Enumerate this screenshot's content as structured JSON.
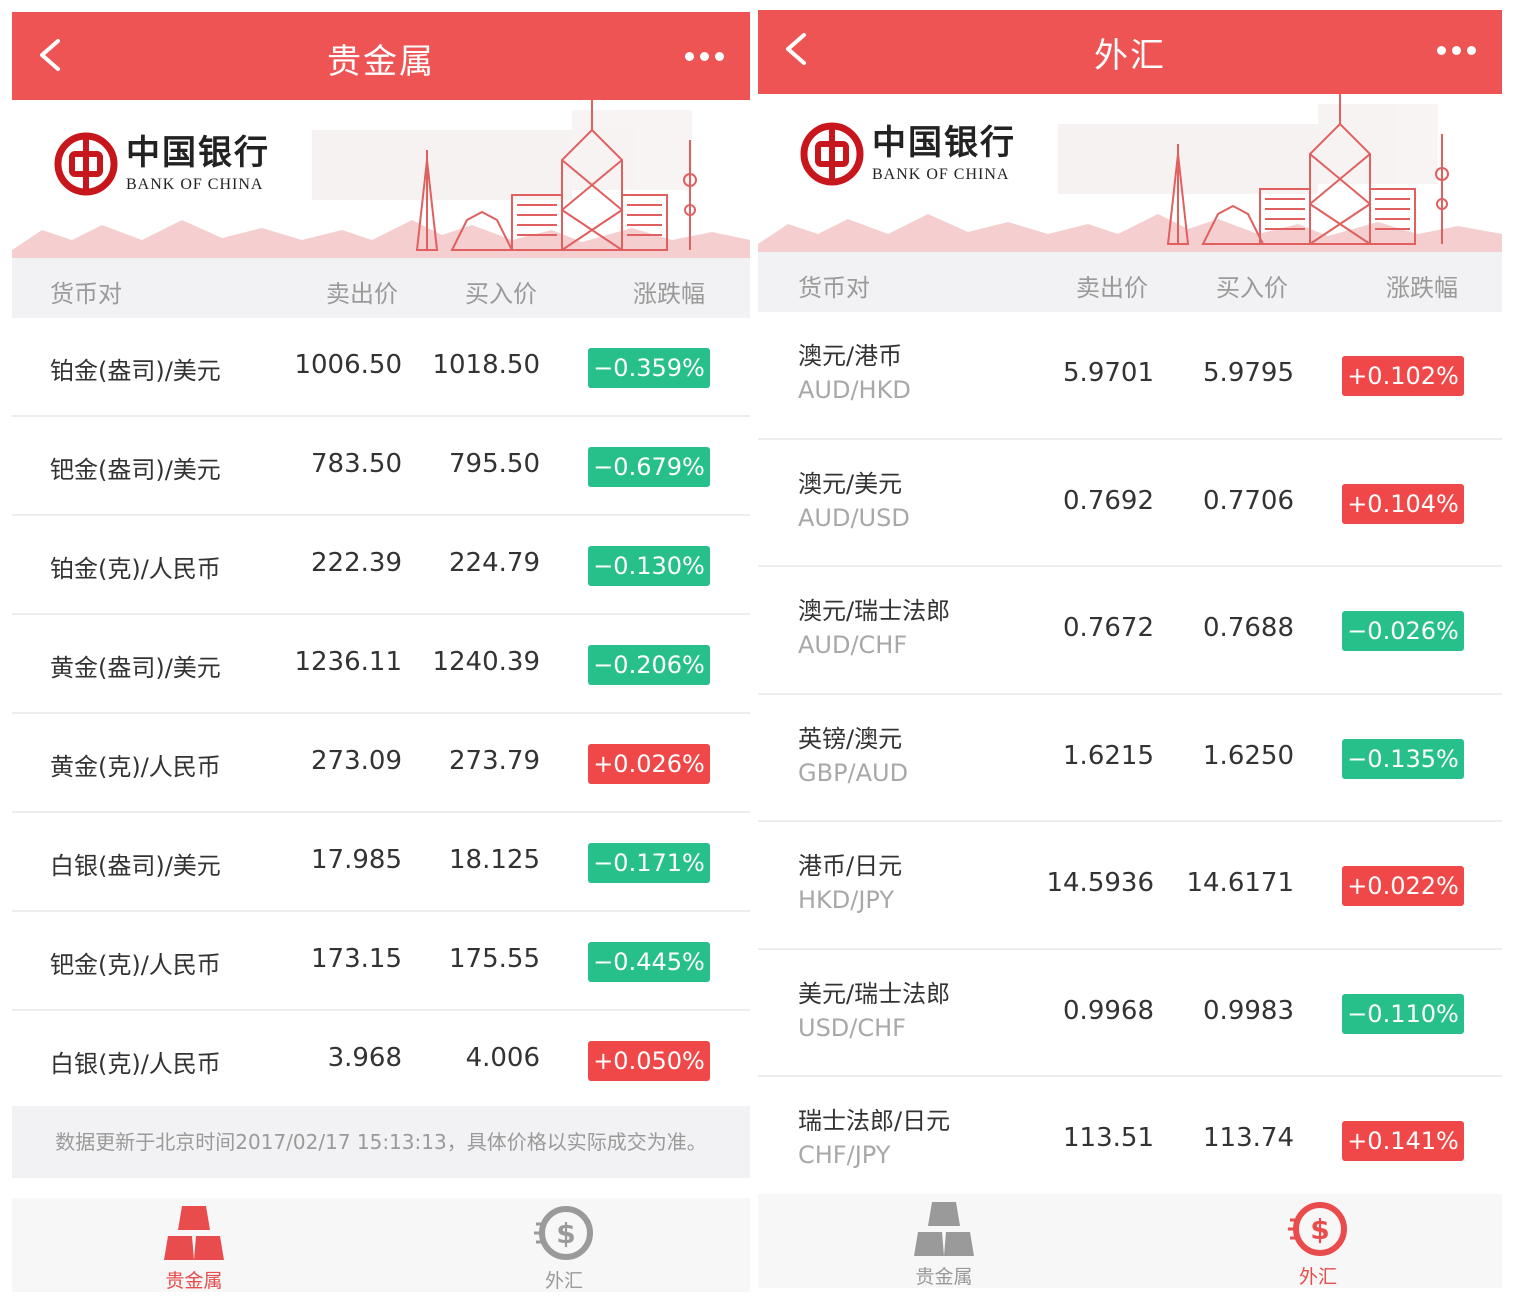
{
  "left": {
    "title": "贵金属",
    "columns": [
      "货币对",
      "卖出价",
      "买入价",
      "涨跌幅"
    ],
    "rows": [
      {
        "name": "铂金(盎司)/美元",
        "sell": "1006.50",
        "buy": "1018.50",
        "change": "−0.359%",
        "dir": "down"
      },
      {
        "name": "钯金(盎司)/美元",
        "sell": "783.50",
        "buy": "795.50",
        "change": "−0.679%",
        "dir": "down"
      },
      {
        "name": "铂金(克)/人民币",
        "sell": "222.39",
        "buy": "224.79",
        "change": "−0.130%",
        "dir": "down"
      },
      {
        "name": "黄金(盎司)/美元",
        "sell": "1236.11",
        "buy": "1240.39",
        "change": "−0.206%",
        "dir": "down"
      },
      {
        "name": "黄金(克)/人民币",
        "sell": "273.09",
        "buy": "273.79",
        "change": "+0.026%",
        "dir": "up"
      },
      {
        "name": "白银(盎司)/美元",
        "sell": "17.985",
        "buy": "18.125",
        "change": "−0.171%",
        "dir": "down"
      },
      {
        "name": "钯金(克)/人民币",
        "sell": "173.15",
        "buy": "175.55",
        "change": "−0.445%",
        "dir": "down"
      },
      {
        "name": "白银(克)/人民币",
        "sell": "3.968",
        "buy": "4.006",
        "change": "+0.050%",
        "dir": "up"
      }
    ],
    "note": "数据更新于北京时间2017/02/17 15:13:13，具体价格以实际成交为准。"
  },
  "right": {
    "title": "外汇",
    "columns": [
      "货币对",
      "卖出价",
      "买入价",
      "涨跌幅"
    ],
    "rows": [
      {
        "name": "澳元/港币",
        "code": "AUD/HKD",
        "sell": "5.9701",
        "buy": "5.9795",
        "change": "+0.102%",
        "dir": "up"
      },
      {
        "name": "澳元/美元",
        "code": "AUD/USD",
        "sell": "0.7692",
        "buy": "0.7706",
        "change": "+0.104%",
        "dir": "up"
      },
      {
        "name": "澳元/瑞士法郎",
        "code": "AUD/CHF",
        "sell": "0.7672",
        "buy": "0.7688",
        "change": "−0.026%",
        "dir": "down"
      },
      {
        "name": "英镑/澳元",
        "code": "GBP/AUD",
        "sell": "1.6215",
        "buy": "1.6250",
        "change": "−0.135%",
        "dir": "down"
      },
      {
        "name": "港币/日元",
        "code": "HKD/JPY",
        "sell": "14.5936",
        "buy": "14.6171",
        "change": "+0.022%",
        "dir": "up"
      },
      {
        "name": "美元/瑞士法郎",
        "code": "USD/CHF",
        "sell": "0.9968",
        "buy": "0.9983",
        "change": "−0.110%",
        "dir": "down"
      },
      {
        "name": "瑞士法郎/日元",
        "code": "CHF/JPY",
        "sell": "113.51",
        "buy": "113.74",
        "change": "+0.141%",
        "dir": "up"
      }
    ]
  },
  "brand": {
    "cn": "中国银行",
    "en": "BANK OF CHINA"
  },
  "tabs": {
    "metals": "贵金属",
    "forex": "外汇"
  },
  "icons": {
    "back": "chevron-left-icon",
    "more": "more-dots-icon",
    "metals": "gold-bars-icon",
    "forex": "currency-exchange-icon"
  },
  "colors": {
    "header": "#ee5454",
    "up": "#f04848",
    "down": "#27c08a",
    "active_tab": "#e84c4c",
    "inactive_tab": "#9a9a9a"
  }
}
